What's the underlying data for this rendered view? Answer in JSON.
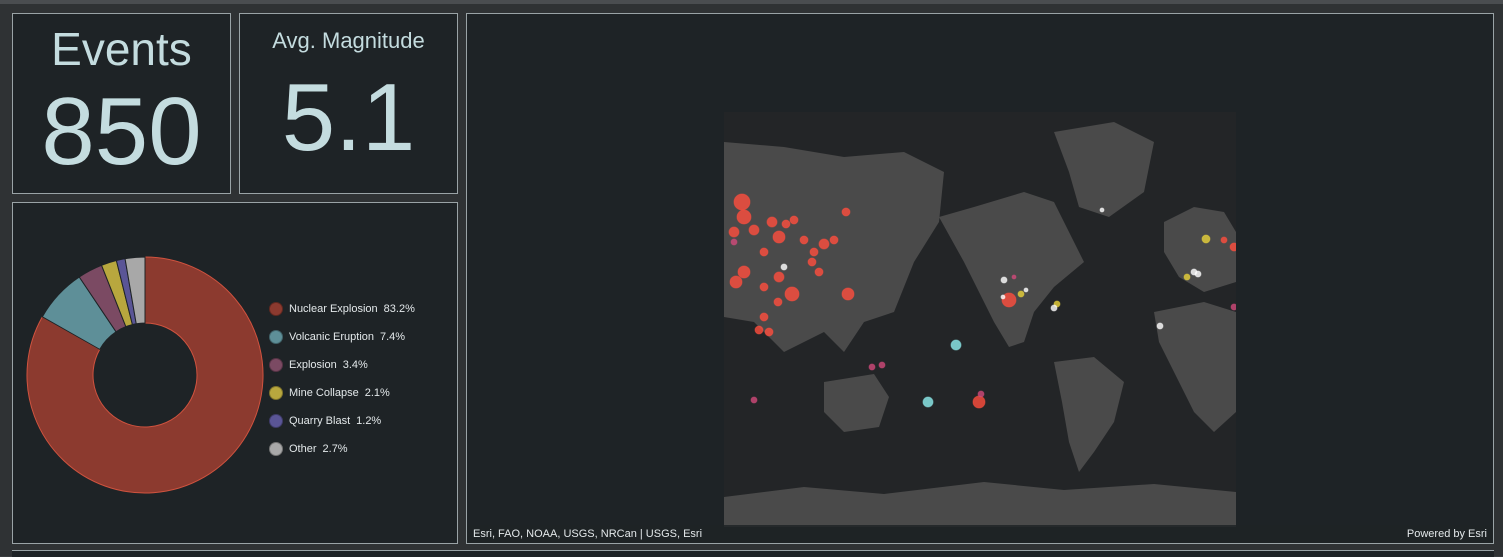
{
  "indicators": {
    "events": {
      "title": "Events",
      "value": "850"
    },
    "avg_magnitude": {
      "title": "Avg. Magnitude",
      "value": "5.1"
    }
  },
  "chart_data": {
    "type": "pie",
    "donut": true,
    "categories": [
      "Nuclear Explosion",
      "Volcanic Eruption",
      "Explosion",
      "Mine Collapse",
      "Quarry Blast",
      "Other"
    ],
    "values": [
      83.2,
      7.4,
      3.4,
      2.1,
      1.2,
      2.7
    ],
    "labels": [
      "83.2%",
      "7.4%",
      "3.4%",
      "2.1%",
      "1.2%",
      "2.7%"
    ],
    "colors": [
      "#8c3a2f",
      "#5e8f98",
      "#7b4a63",
      "#b8a73e",
      "#5a5596",
      "#a8a8a8"
    ],
    "legend": "right"
  },
  "map": {
    "attribution_left": "Esri, FAO, NOAA, USGS, NRCan | USGS, Esri",
    "attribution_right": "Powered by Esri",
    "colors": {
      "nuclear": "#ff4d3d",
      "volcanic": "#8ff0f0",
      "explosion": "#d14a7a",
      "mine": "#e8d23a",
      "quarry": "#7a70d0",
      "other": "#ffffff",
      "land": "#4a4a4a",
      "water": "#232527"
    }
  }
}
